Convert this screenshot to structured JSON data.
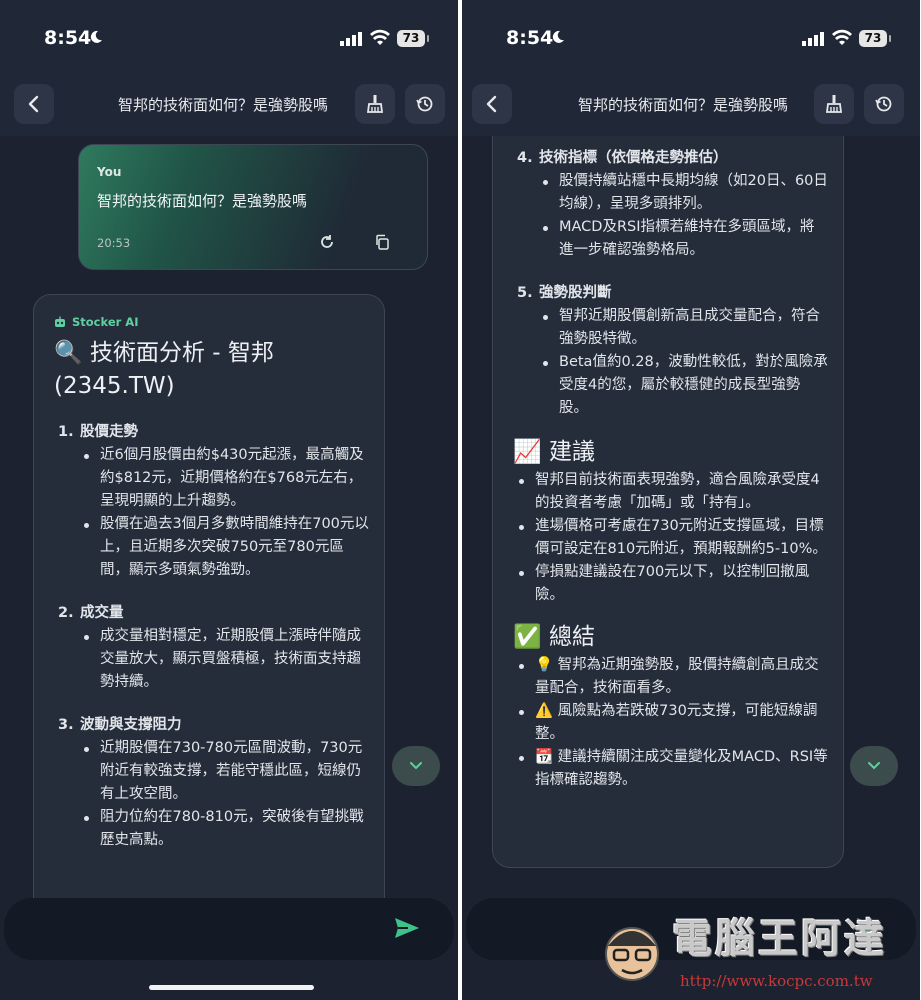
{
  "status": {
    "time": "8:54",
    "battery": "73"
  },
  "header": {
    "title": "智邦的技術面如何？是強勢股嗎"
  },
  "user_message": {
    "sender": "You",
    "text": "智邦的技術面如何？是強勢股嗎",
    "time": "20:53"
  },
  "ai_message": {
    "sender": "Stocker AI",
    "heading_icon": "🔍",
    "heading": "技術面分析 - 智邦 (2345.TW)",
    "sections": [
      {
        "num": "1.",
        "title": "股價走勢",
        "items": [
          "近6個月股價由約$430元起漲，最高觸及約$812元，近期價格約在$768元左右，呈現明顯的上升趨勢。",
          "股價在過去3個月多數時間維持在700元以上，且近期多次突破750元至780元區間，顯示多頭氣勢強勁。"
        ]
      },
      {
        "num": "2.",
        "title": "成交量",
        "items": [
          "成交量相對穩定，近期股價上漲時伴隨成交量放大，顯示買盤積極，技術面支持趨勢持續。"
        ]
      },
      {
        "num": "3.",
        "title": "波動與支撐阻力",
        "items": [
          "近期股價在730-780元區間波動，730元附近有較強支撐，若能守穩此區，短線仍有上攻空間。",
          "阻力位約在780-810元，突破後有望挑戰歷史高點。"
        ]
      },
      {
        "num": "4.",
        "title": "技術指標（依價格走勢推估）",
        "items": [
          "股價持續站穩中長期均線（如20日、60日均線），呈現多頭排列。",
          "MACD及RSI指標若維持在多頭區域，將進一步確認強勢格局。"
        ]
      },
      {
        "num": "5.",
        "title": "強勢股判斷",
        "items": [
          "智邦近期股價創新高且成交量配合，符合強勢股特徵。",
          "Beta值約0.28，波動性較低，對於風險承受度4的您，屬於較穩健的成長型強勢股。"
        ]
      }
    ],
    "advice": {
      "icon": "📈",
      "heading": "建議",
      "items": [
        "智邦目前技術面表現強勢，適合風險承受度4的投資者考慮「加碼」或「持有」。",
        "進場價格可考慮在730元附近支撐區域，目標價可設定在810元附近，預期報酬約5-10%。",
        "停損點建議設在700元以下，以控制回撤風險。"
      ]
    },
    "summary": {
      "icon": "✅",
      "heading": "總結",
      "items": [
        {
          "icon": "💡",
          "text": "智邦為近期強勢股，股價持續創高且成交量配合，技術面看多。"
        },
        {
          "icon": "⚠️",
          "text": "風險點為若跌破730元支撐，可能短線調整。"
        },
        {
          "icon": "📆",
          "text": "建議持續關注成交量變化及MACD、RSI等指標確認趨勢。"
        }
      ]
    }
  },
  "watermark": {
    "title": "電腦王阿達",
    "url": "http://www.kocpc.com.tw"
  },
  "colors": {
    "background": "#1c2230",
    "accent": "#3fc28a",
    "bubble": "#252d3b"
  }
}
